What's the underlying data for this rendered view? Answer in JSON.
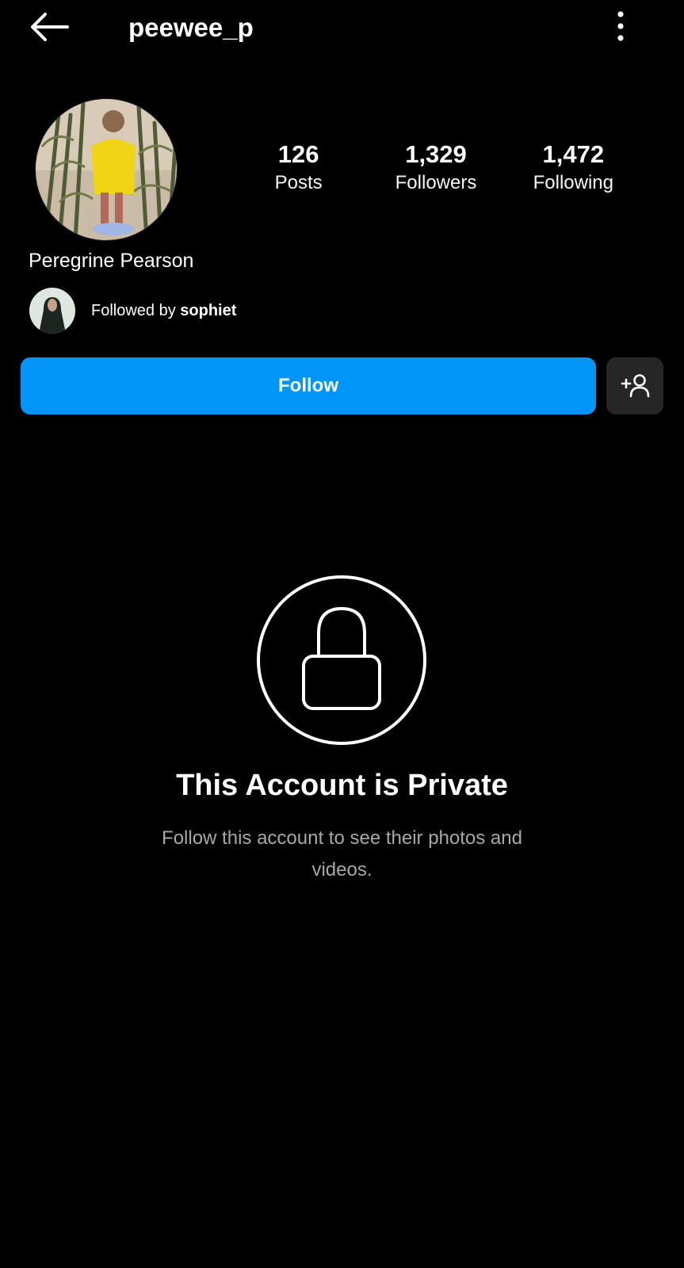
{
  "header": {
    "username": "peewee_p"
  },
  "profile": {
    "full_name": "Peregrine Pearson",
    "stats": [
      {
        "value": "126",
        "label": "Posts"
      },
      {
        "value": "1,329",
        "label": "Followers"
      },
      {
        "value": "1,472",
        "label": "Following"
      }
    ],
    "followed_by_prefix": "Followed by ",
    "followed_by_user": "sophiet"
  },
  "actions": {
    "follow_label": "Follow"
  },
  "private": {
    "title": "This Account is Private",
    "description": "Follow this account to see their photos and videos."
  },
  "colors": {
    "background": "#000000",
    "follow_button": "#0095f6",
    "secondary_button": "#262626",
    "muted_text": "#a8a8a8"
  }
}
